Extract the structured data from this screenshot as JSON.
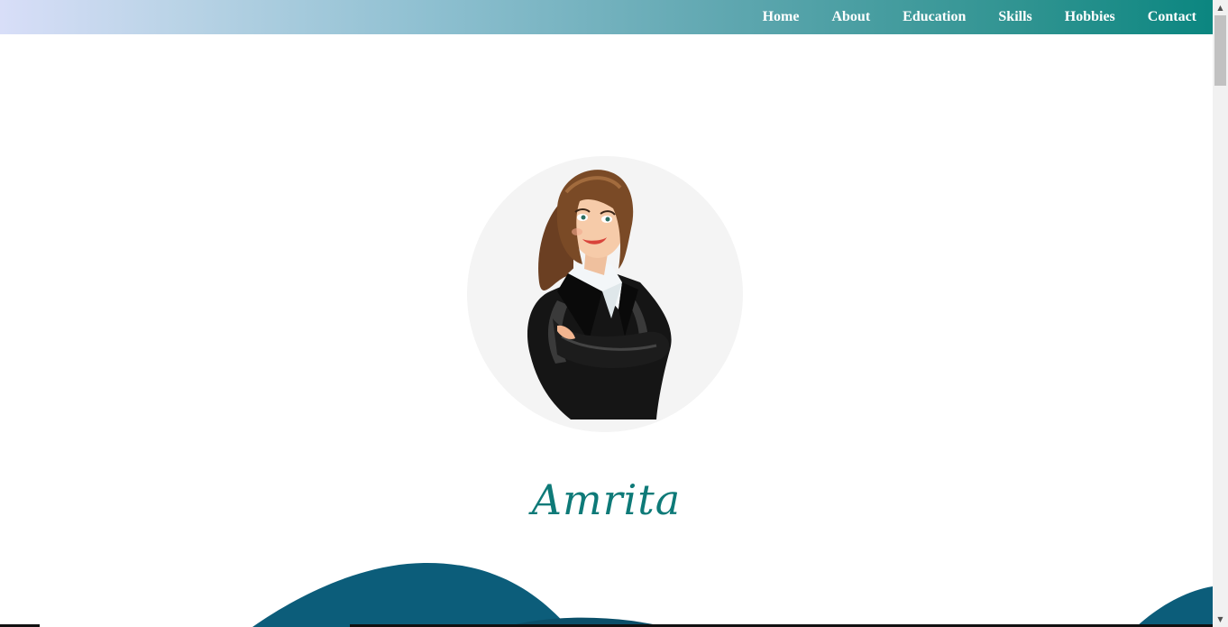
{
  "nav": {
    "items": [
      {
        "label": "Home"
      },
      {
        "label": "About"
      },
      {
        "label": "Education"
      },
      {
        "label": "Skills"
      },
      {
        "label": "Hobbies"
      },
      {
        "label": "Contact"
      }
    ]
  },
  "hero": {
    "name": "Amrita",
    "avatar_icon": "businesswoman-avatar-icon"
  },
  "colors": {
    "accent": "#0e7a78",
    "nav_gradient_start": "#d8def8",
    "nav_gradient_end": "#0b8680",
    "wave": "#0c5d7a"
  },
  "scrollbar": {
    "up_icon": "chevron-up-icon",
    "down_icon": "chevron-down-icon"
  }
}
